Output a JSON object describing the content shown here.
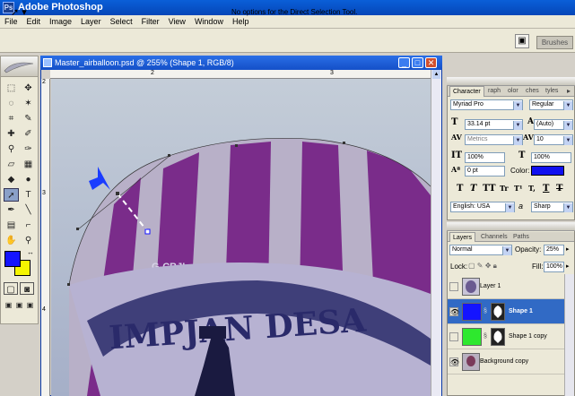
{
  "app": {
    "title": "Adobe Photoshop",
    "logo": "Ps"
  },
  "menu": [
    "File",
    "Edit",
    "Image",
    "Layer",
    "Select",
    "Filter",
    "View",
    "Window",
    "Help"
  ],
  "options": {
    "message": "No options for the Direct Selection Tool.",
    "brushes_tab": "Brushes"
  },
  "document": {
    "title": "Master_airballoon.psd @ 255% (Shape 1, RGB/8)",
    "ruler_top": [
      "2",
      "3"
    ],
    "ruler_left": [
      "2",
      "3",
      "4"
    ],
    "balloon_registration": "G-CBJI",
    "banner_text": "IMPJAN DESA"
  },
  "character": {
    "tabs": [
      "Character",
      "raph",
      "olor",
      "ches",
      "tyles"
    ],
    "font_family": "Myriad Pro",
    "font_style": "Regular",
    "font_size": "33.14 pt",
    "leading": "(Auto)",
    "kerning": "Metrics",
    "tracking": "10",
    "vertical_scale": "100%",
    "horizontal_scale": "100%",
    "baseline_shift": "0 pt",
    "color_label": "Color:",
    "text_color": "#1010f0",
    "style_buttons": [
      "T",
      "T",
      "TT",
      "Tr",
      "T¹",
      "T,",
      "T",
      "T"
    ],
    "language": "English: USA",
    "aa_icon": "a",
    "antialias": "Sharp"
  },
  "layers_panel": {
    "tabs": [
      "Layers",
      "Channels",
      "Paths"
    ],
    "blend_mode": "Normal",
    "opacity_label": "Opacity:",
    "opacity": "25%",
    "lock_label": "Lock:",
    "fill_label": "Fill:",
    "fill": "100%",
    "layers": [
      {
        "name": "Layer 1",
        "visible": false,
        "selected": false,
        "thumb_color": "#8a8ab0"
      },
      {
        "name": "Shape 1",
        "visible": true,
        "selected": true,
        "thumb_color": "#1414ff"
      },
      {
        "name": "Shape 1 copy",
        "visible": false,
        "selected": false,
        "thumb_color": "#2ee82e"
      },
      {
        "name": "Background copy",
        "visible": true,
        "selected": false,
        "thumb_color": "#a09090"
      }
    ]
  },
  "colors": {
    "foreground": "#1414ff",
    "background": "#f5f500",
    "accent": "#316ac5"
  }
}
